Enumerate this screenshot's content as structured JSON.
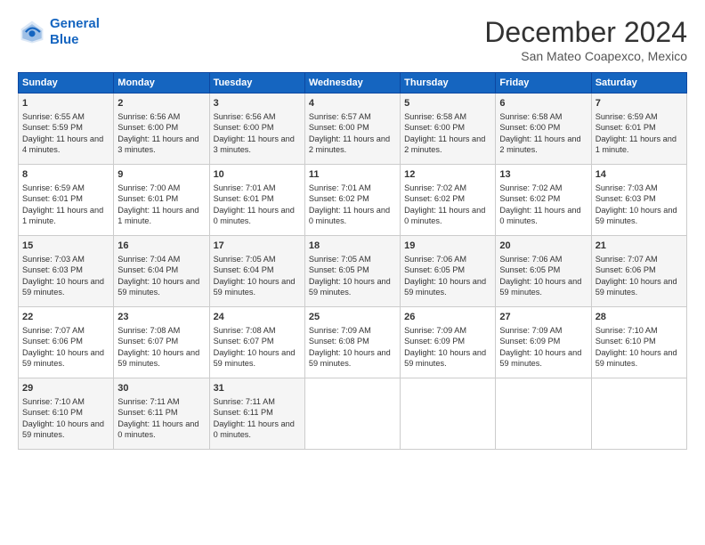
{
  "header": {
    "logo_line1": "General",
    "logo_line2": "Blue",
    "month": "December 2024",
    "location": "San Mateo Coapexco, Mexico"
  },
  "columns": [
    "Sunday",
    "Monday",
    "Tuesday",
    "Wednesday",
    "Thursday",
    "Friday",
    "Saturday"
  ],
  "weeks": [
    [
      {
        "day": "1",
        "text": "Sunrise: 6:55 AM\nSunset: 5:59 PM\nDaylight: 11 hours and 4 minutes."
      },
      {
        "day": "2",
        "text": "Sunrise: 6:56 AM\nSunset: 6:00 PM\nDaylight: 11 hours and 3 minutes."
      },
      {
        "day": "3",
        "text": "Sunrise: 6:56 AM\nSunset: 6:00 PM\nDaylight: 11 hours and 3 minutes."
      },
      {
        "day": "4",
        "text": "Sunrise: 6:57 AM\nSunset: 6:00 PM\nDaylight: 11 hours and 2 minutes."
      },
      {
        "day": "5",
        "text": "Sunrise: 6:58 AM\nSunset: 6:00 PM\nDaylight: 11 hours and 2 minutes."
      },
      {
        "day": "6",
        "text": "Sunrise: 6:58 AM\nSunset: 6:00 PM\nDaylight: 11 hours and 2 minutes."
      },
      {
        "day": "7",
        "text": "Sunrise: 6:59 AM\nSunset: 6:01 PM\nDaylight: 11 hours and 1 minute."
      }
    ],
    [
      {
        "day": "8",
        "text": "Sunrise: 6:59 AM\nSunset: 6:01 PM\nDaylight: 11 hours and 1 minute."
      },
      {
        "day": "9",
        "text": "Sunrise: 7:00 AM\nSunset: 6:01 PM\nDaylight: 11 hours and 1 minute."
      },
      {
        "day": "10",
        "text": "Sunrise: 7:01 AM\nSunset: 6:01 PM\nDaylight: 11 hours and 0 minutes."
      },
      {
        "day": "11",
        "text": "Sunrise: 7:01 AM\nSunset: 6:02 PM\nDaylight: 11 hours and 0 minutes."
      },
      {
        "day": "12",
        "text": "Sunrise: 7:02 AM\nSunset: 6:02 PM\nDaylight: 11 hours and 0 minutes."
      },
      {
        "day": "13",
        "text": "Sunrise: 7:02 AM\nSunset: 6:02 PM\nDaylight: 11 hours and 0 minutes."
      },
      {
        "day": "14",
        "text": "Sunrise: 7:03 AM\nSunset: 6:03 PM\nDaylight: 10 hours and 59 minutes."
      }
    ],
    [
      {
        "day": "15",
        "text": "Sunrise: 7:03 AM\nSunset: 6:03 PM\nDaylight: 10 hours and 59 minutes."
      },
      {
        "day": "16",
        "text": "Sunrise: 7:04 AM\nSunset: 6:04 PM\nDaylight: 10 hours and 59 minutes."
      },
      {
        "day": "17",
        "text": "Sunrise: 7:05 AM\nSunset: 6:04 PM\nDaylight: 10 hours and 59 minutes."
      },
      {
        "day": "18",
        "text": "Sunrise: 7:05 AM\nSunset: 6:05 PM\nDaylight: 10 hours and 59 minutes."
      },
      {
        "day": "19",
        "text": "Sunrise: 7:06 AM\nSunset: 6:05 PM\nDaylight: 10 hours and 59 minutes."
      },
      {
        "day": "20",
        "text": "Sunrise: 7:06 AM\nSunset: 6:05 PM\nDaylight: 10 hours and 59 minutes."
      },
      {
        "day": "21",
        "text": "Sunrise: 7:07 AM\nSunset: 6:06 PM\nDaylight: 10 hours and 59 minutes."
      }
    ],
    [
      {
        "day": "22",
        "text": "Sunrise: 7:07 AM\nSunset: 6:06 PM\nDaylight: 10 hours and 59 minutes."
      },
      {
        "day": "23",
        "text": "Sunrise: 7:08 AM\nSunset: 6:07 PM\nDaylight: 10 hours and 59 minutes."
      },
      {
        "day": "24",
        "text": "Sunrise: 7:08 AM\nSunset: 6:07 PM\nDaylight: 10 hours and 59 minutes."
      },
      {
        "day": "25",
        "text": "Sunrise: 7:09 AM\nSunset: 6:08 PM\nDaylight: 10 hours and 59 minutes."
      },
      {
        "day": "26",
        "text": "Sunrise: 7:09 AM\nSunset: 6:09 PM\nDaylight: 10 hours and 59 minutes."
      },
      {
        "day": "27",
        "text": "Sunrise: 7:09 AM\nSunset: 6:09 PM\nDaylight: 10 hours and 59 minutes."
      },
      {
        "day": "28",
        "text": "Sunrise: 7:10 AM\nSunset: 6:10 PM\nDaylight: 10 hours and 59 minutes."
      }
    ],
    [
      {
        "day": "29",
        "text": "Sunrise: 7:10 AM\nSunset: 6:10 PM\nDaylight: 10 hours and 59 minutes."
      },
      {
        "day": "30",
        "text": "Sunrise: 7:11 AM\nSunset: 6:11 PM\nDaylight: 11 hours and 0 minutes."
      },
      {
        "day": "31",
        "text": "Sunrise: 7:11 AM\nSunset: 6:11 PM\nDaylight: 11 hours and 0 minutes."
      },
      {
        "day": "",
        "text": ""
      },
      {
        "day": "",
        "text": ""
      },
      {
        "day": "",
        "text": ""
      },
      {
        "day": "",
        "text": ""
      }
    ]
  ]
}
